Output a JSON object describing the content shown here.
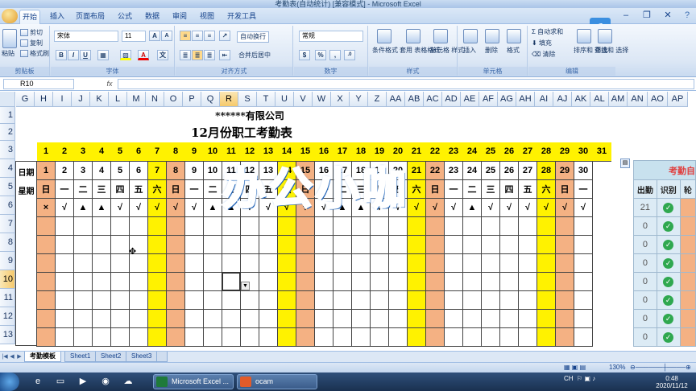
{
  "window": {
    "title": "考勤表(自动统计) [兼容模式] - Microsoft Excel"
  },
  "ribbon": {
    "tabs": [
      "开始",
      "插入",
      "页面布局",
      "公式",
      "数据",
      "审阅",
      "视图",
      "开发工具"
    ],
    "clipboard": {
      "label": "剪贴板",
      "paste": "粘贴",
      "cut": "剪切",
      "copy": "复制",
      "format_painter": "格式刷"
    },
    "font": {
      "label": "字体",
      "name": "宋体",
      "size": "11"
    },
    "alignment": {
      "label": "对齐方式",
      "wrap": "自动换行",
      "merge": "合并后居中"
    },
    "number": {
      "label": "数字",
      "format": "常规"
    },
    "styles": {
      "label": "样式",
      "conditional": "条件格式",
      "table": "套用 表格格式",
      "cell": "单元格 样式"
    },
    "cells": {
      "label": "单元格",
      "insert": "插入",
      "delete": "删除",
      "format": "格式"
    },
    "editing": {
      "label": "编辑",
      "autosum": "自动求和",
      "fill": "填充",
      "clear": "清除",
      "sort": "排序和 筛选",
      "find": "查找和 选择"
    }
  },
  "formula_bar": {
    "name_box": "R10",
    "fx": "fx",
    "value": ""
  },
  "columns": [
    "G",
    "H",
    "I",
    "J",
    "K",
    "L",
    "M",
    "N",
    "O",
    "P",
    "Q",
    "R",
    "S",
    "T",
    "U",
    "V",
    "W",
    "X",
    "Y",
    "Z",
    "AA",
    "AB",
    "AC",
    "AD",
    "AE",
    "AF",
    "AG",
    "AH",
    "AI",
    "AJ",
    "AK",
    "AL",
    "AM",
    "AN",
    "AO",
    "AP"
  ],
  "selected_column": "R",
  "rows": [
    "1",
    "2",
    "3",
    "4",
    "5",
    "6",
    "7",
    "8",
    "9",
    "10",
    "11",
    "12",
    "13"
  ],
  "selected_row": "10",
  "sheet": {
    "company": "******有限公司",
    "title": "12月份职工考勤表",
    "label_date": "日期",
    "label_week": "星期",
    "header_days": [
      "1",
      "2",
      "3",
      "4",
      "5",
      "6",
      "7",
      "8",
      "9",
      "10",
      "11",
      "12",
      "13",
      "14",
      "15",
      "16",
      "17",
      "18",
      "19",
      "20",
      "21",
      "22",
      "23",
      "24",
      "25",
      "26",
      "27",
      "28",
      "29",
      "30",
      "31"
    ],
    "dates": [
      "1",
      "2",
      "3",
      "4",
      "5",
      "6",
      "7",
      "8",
      "9",
      "10",
      "11",
      "12",
      "13",
      "14",
      "15",
      "16",
      "17",
      "18",
      "19",
      "20",
      "21",
      "22",
      "23",
      "24",
      "25",
      "26",
      "27",
      "28",
      "29",
      "30",
      ""
    ],
    "weekdays": [
      "日",
      "一",
      "二",
      "三",
      "四",
      "五",
      "六",
      "日",
      "一",
      "二",
      "三",
      "四",
      "五",
      "六",
      "日",
      "一",
      "二",
      "三",
      "四",
      "五",
      "六",
      "日",
      "一",
      "二",
      "三",
      "四",
      "五",
      "六",
      "日",
      "一",
      ""
    ],
    "marks": [
      "×",
      "√",
      "▲",
      "▲",
      "√",
      "√",
      "√",
      "√",
      "√",
      "▲",
      "▲",
      "√",
      "√",
      "√",
      "√",
      "√",
      "▲",
      "▲",
      "√",
      "√",
      "√",
      "√",
      "√",
      "▲",
      "√",
      "√",
      "√",
      "√",
      "√",
      "√",
      ""
    ],
    "weekend_yellow": [
      7,
      14,
      21,
      28
    ],
    "weekend_peach": [
      1,
      8,
      15,
      22,
      29
    ]
  },
  "stats": {
    "header": "考勤自",
    "col1": "出勤",
    "col2": "识别",
    "col3": "轮",
    "values": [
      "21",
      "0",
      "0",
      "0",
      "0",
      "0",
      "0",
      "0"
    ]
  },
  "overlay": {
    "text": "办公小咖"
  },
  "sheets": [
    "考勤模板",
    "Sheet1",
    "Sheet2",
    "Sheet3"
  ],
  "status": {
    "zoom": "130%"
  },
  "taskbar": {
    "excel": "Microsoft Excel ...",
    "ocam": "ocam",
    "ime": "CH",
    "time": "0:48",
    "date": "2020/11/12"
  },
  "colors": {
    "yellow": "#fff200",
    "peach": "#f4b183",
    "check_green": "#2fa84f",
    "overlay_blue": "#2aa7f0"
  }
}
